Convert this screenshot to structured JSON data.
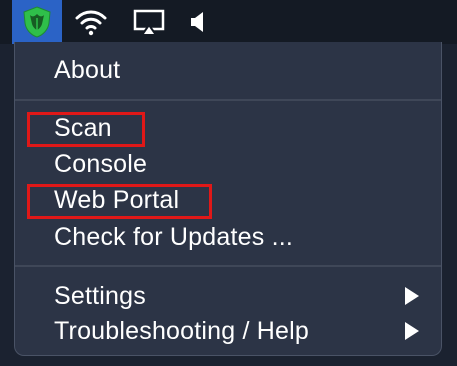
{
  "menubar": {
    "icons": {
      "app": "shield-app-icon",
      "wifi": "wifi-icon",
      "airplay": "airplay-icon",
      "volume": "volume-icon"
    },
    "app_icon_bg": "#2b63c6"
  },
  "menu": {
    "items": [
      {
        "label": "About",
        "has_submenu": false
      },
      {
        "label": "Scan",
        "has_submenu": false,
        "highlighted": true
      },
      {
        "label": "Console",
        "has_submenu": false
      },
      {
        "label": "Web Portal",
        "has_submenu": false,
        "highlighted": true
      },
      {
        "label": "Check for Updates ...",
        "has_submenu": false
      },
      {
        "label": "Settings",
        "has_submenu": true
      },
      {
        "label": "Troubleshooting / Help",
        "has_submenu": true
      }
    ],
    "highlight_color": "#e01818"
  }
}
